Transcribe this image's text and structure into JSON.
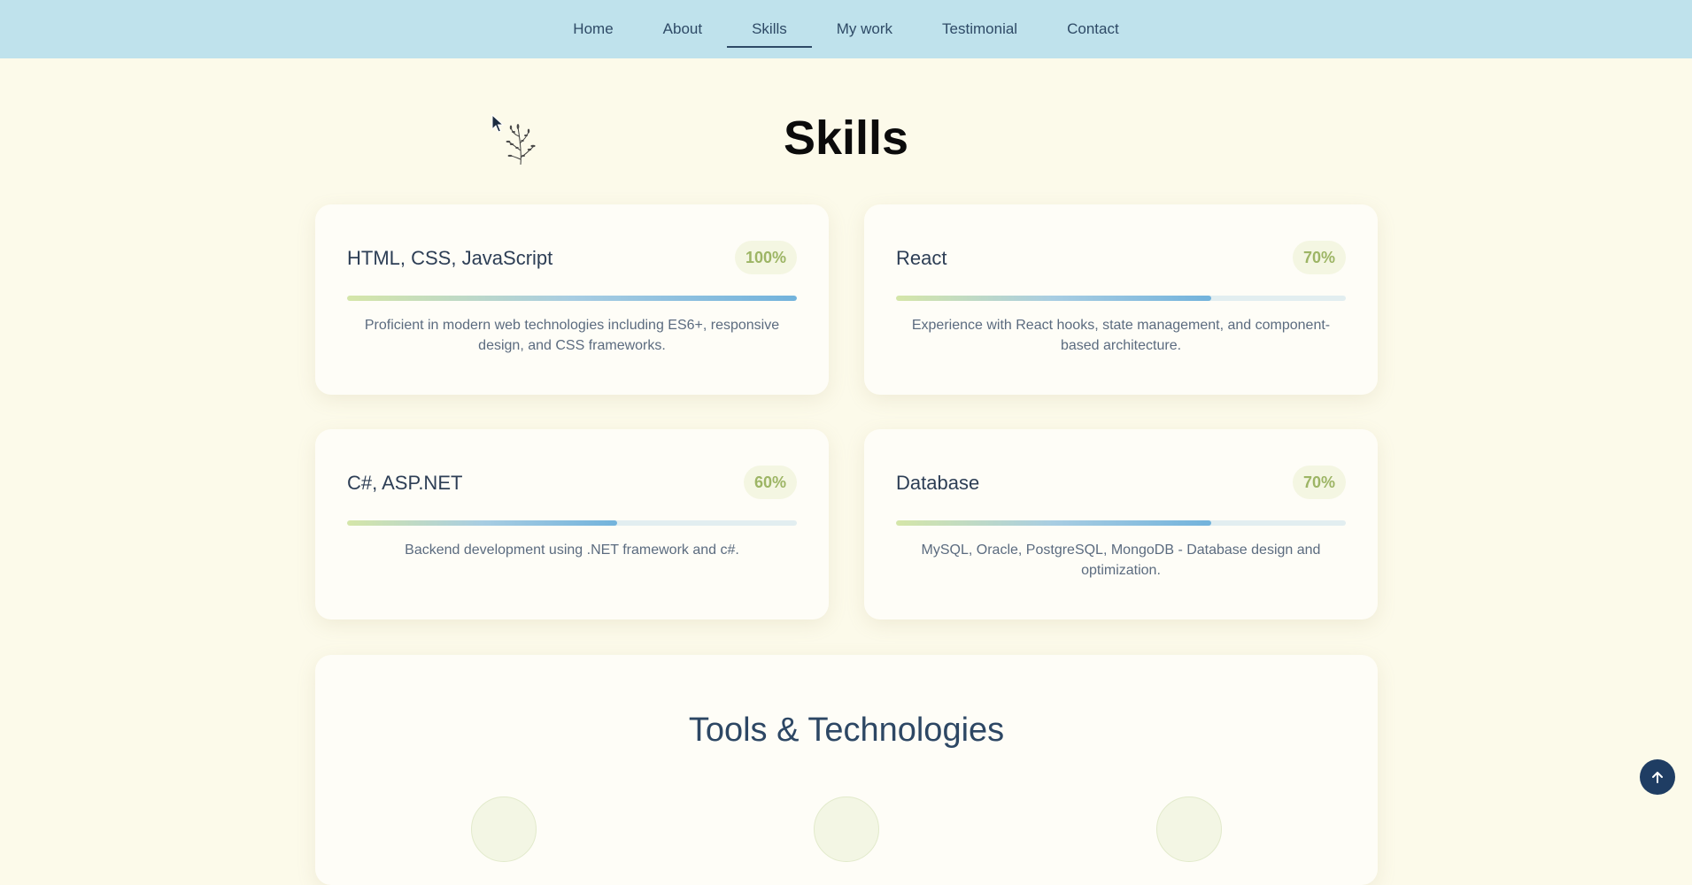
{
  "nav": {
    "items": [
      {
        "label": "Home"
      },
      {
        "label": "About"
      },
      {
        "label": "Skills"
      },
      {
        "label": "My work"
      },
      {
        "label": "Testimonial"
      },
      {
        "label": "Contact"
      }
    ],
    "active": "Skills"
  },
  "skills_section": {
    "title": "Skills",
    "cards": [
      {
        "name": "HTML, CSS, JavaScript",
        "percent_label": "100%",
        "progress": 1.0,
        "description": "Proficient in modern web technologies including ES6+, responsive design, and CSS frameworks."
      },
      {
        "name": "React",
        "percent_label": "70%",
        "progress": 0.7,
        "description": "Experience with React hooks, state management, and component-based architecture."
      },
      {
        "name": "C#, ASP.NET",
        "percent_label": "60%",
        "progress": 0.6,
        "description": "Backend development using .NET framework and c#."
      },
      {
        "name": "Database",
        "percent_label": "70%",
        "progress": 0.7,
        "description": "MySQL, Oracle, PostgreSQL, MongoDB - Database design and optimization."
      }
    ]
  },
  "tools_section": {
    "title": "Tools & Technologies"
  },
  "icons": {
    "decoration": "sprig-icon",
    "back_to_top": "arrow-up-icon",
    "pointer": "mouse-cursor-icon"
  },
  "colors": {
    "nav_bg": "#bfe2ec",
    "page_bg": "#fcfaea",
    "card_bg": "#fefdf7",
    "badge_text": "#9db565",
    "badge_bg": "#f4f6e2",
    "progress_start": "#d5e6a8",
    "progress_end": "#72b3dc",
    "back_to_top_bg": "#1f3d63"
  }
}
